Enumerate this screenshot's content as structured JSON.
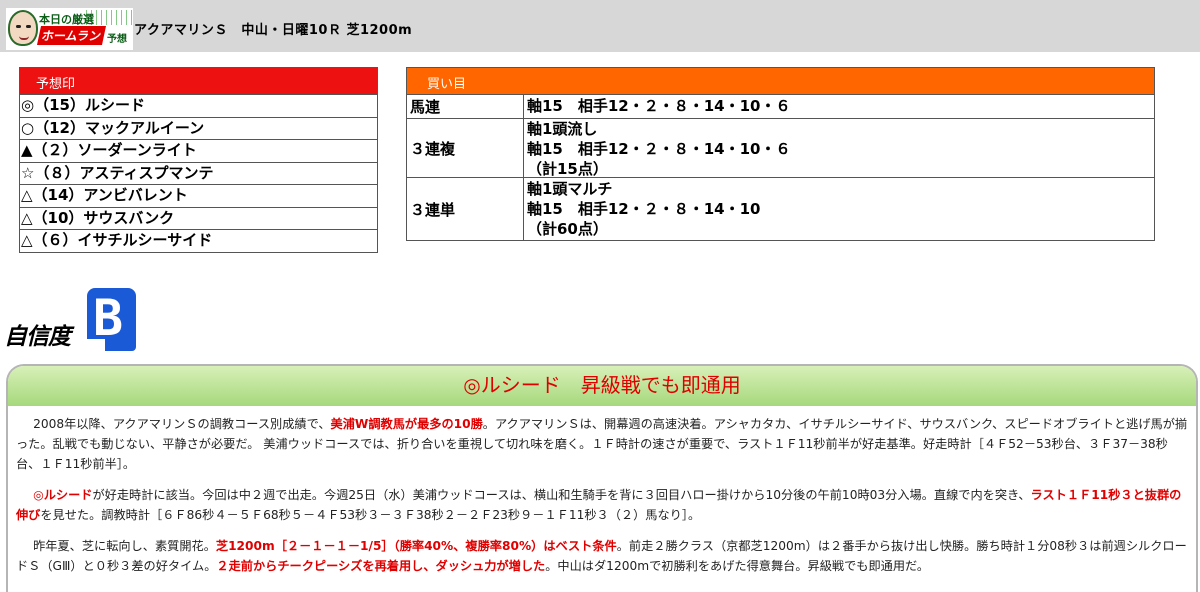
{
  "header": {
    "logo": {
      "line1": "本日の厳選",
      "line2": "ホームラン",
      "line3": "予想"
    },
    "race_title": "アクアマリンＳ　中山・日曜10Ｒ 芝1200m"
  },
  "prediction": {
    "heading": "予想印",
    "rows": [
      "◎（15）ルシード",
      "○（12）マックアルイーン",
      "▲（２）ソーダーンライト",
      "☆（８）アスティスプマンテ",
      "△（14）アンビバレント",
      "△（10）サウスバンク",
      "△（６）イサチルシーサイド"
    ]
  },
  "buy": {
    "heading": "買い目",
    "rows": [
      {
        "type": "馬連",
        "lines": [
          "軸15　相手12・２・８・14・10・６"
        ]
      },
      {
        "type": "３連複",
        "lines": [
          "軸1頭流し",
          "軸15　相手12・２・８・14・10・６",
          "（計15点）"
        ]
      },
      {
        "type": "３連単",
        "lines": [
          "軸1頭マルチ",
          "軸15　相手12・２・８・14・10",
          "（計60点）"
        ]
      }
    ]
  },
  "confidence": {
    "label": "自信度",
    "grade": "B"
  },
  "comment": {
    "title": "◎ルシード　昇級戦でも即通用",
    "p1": [
      "2008年以降、アクアマリンＳの調教コース別成績で、",
      "美浦W調教馬が最多の10勝",
      "。アクアマリンＳは、開幕週の高速決着。アシャカタカ、イサチルシーサイド、サウスバンク、スピードオブライトと逃げ馬が揃った。乱戦でも動じない、平静さが必要だ。 美浦ウッドコースでは、折り合いを重視して切れ味を磨く。１Ｆ時計の速さが重要で、ラスト１Ｆ11秒前半が好走基準。好走時計［４Ｆ52－53秒台、３Ｆ37－38秒台、１Ｆ11秒前半］。"
    ],
    "p2": [
      "◎ルシード",
      "が好走時計に該当。今回は中２週で出走。今週25日（水）美浦ウッドコースは、横山和生騎手を背に３回目ハロー掛けから10分後の午前10時03分入場。直線で内を突き、",
      "ラスト１Ｆ11秒３と抜群の伸び",
      "を見せた。調教時計［６Ｆ86秒４－５Ｆ68秒５－４Ｆ53秒３－３Ｆ38秒２－２Ｆ23秒９－１Ｆ11秒３（２）馬なり］。"
    ],
    "p3": [
      "昨年夏、芝に転向し、素質開花。",
      "芝1200m［２－１－１－1/5］（勝率40%、複勝率80%）はベスト条件",
      "。前走２勝クラス（京都芝1200m）は２番手から抜け出し快勝。勝ち時計１分08秒３は前週シルクロードＳ（GⅢ）と０秒３差の好タイム。",
      "２走前からチークピーシズを再着用し、ダッシュ力が増した",
      "。中山はダ1200mで初勝利をあげた得意舞台。昇級戦でも即通用だ。"
    ]
  }
}
